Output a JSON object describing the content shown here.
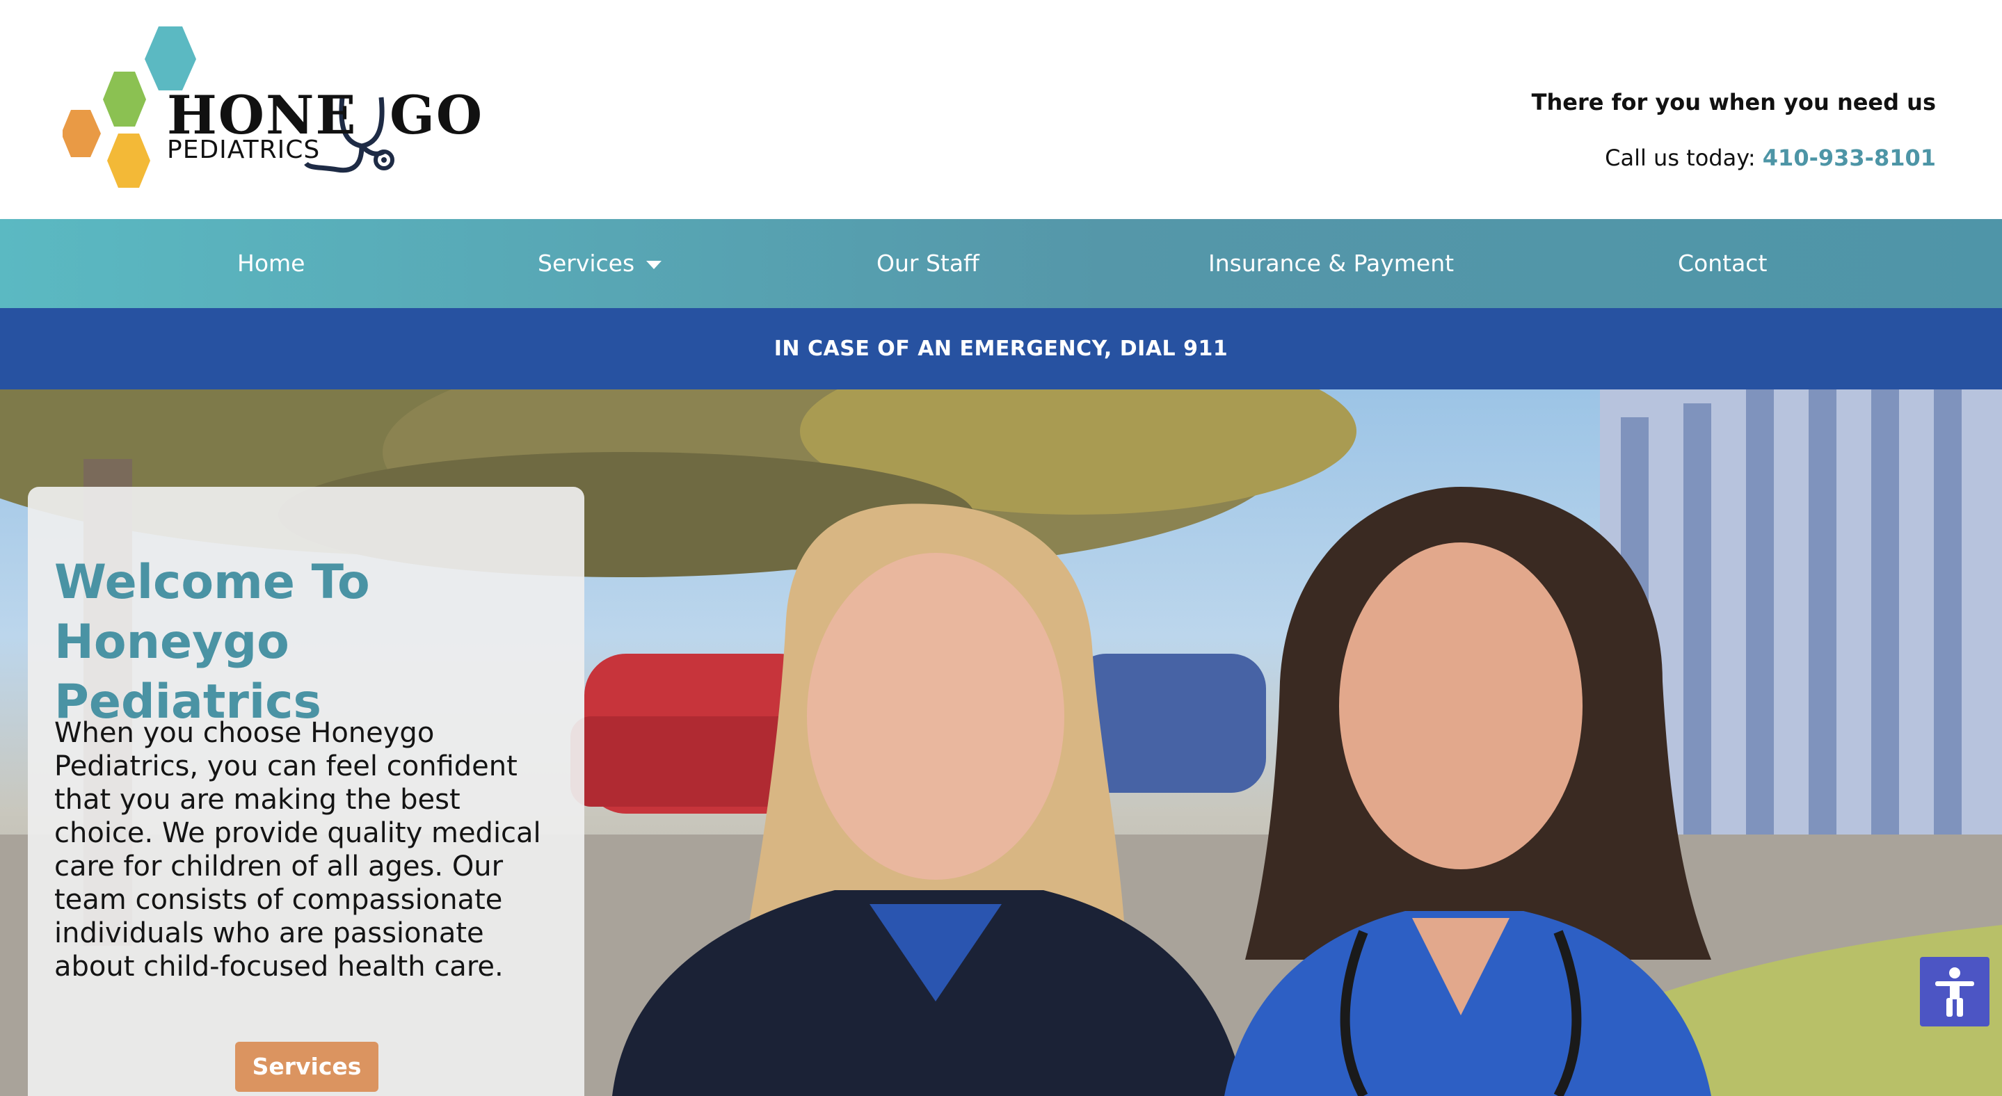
{
  "logo": {
    "word_left": "HONE",
    "word_right": "GO",
    "sub": "PEDIATRICS",
    "hex_colors": [
      "#5bb9c2",
      "#8bc152",
      "#e99a45",
      "#f3b937"
    ]
  },
  "header": {
    "tagline": "There for you when you need us",
    "call_prefix": "Call us today:",
    "phone": "410-933-8101"
  },
  "nav": {
    "items": [
      {
        "label": "Home"
      },
      {
        "label": "Services",
        "has_dropdown": true
      },
      {
        "label": "Our Staff"
      },
      {
        "label": "Insurance & Payment"
      },
      {
        "label": "Contact"
      }
    ]
  },
  "emergency": {
    "text": "IN CASE OF AN EMERGENCY, DIAL 911"
  },
  "hero": {
    "title_line1": "Welcome To",
    "title_line2": "Honeygo Pediatrics",
    "body": "When you choose Honeygo Pediatrics, you can feel confident that you are making the best choice. We provide quality medical care for children of all ages. Our team consists of compassionate individuals who are passionate about child-focused health care.",
    "button_label": "Services"
  },
  "accessibility": {
    "icon": "accessibility-icon"
  },
  "colors": {
    "accent_teal": "#4a93a4",
    "nav_teal": "#5597a9",
    "emergency_blue": "#2752a1",
    "button_orange": "#db9460",
    "access_purple": "#4c55c4"
  }
}
